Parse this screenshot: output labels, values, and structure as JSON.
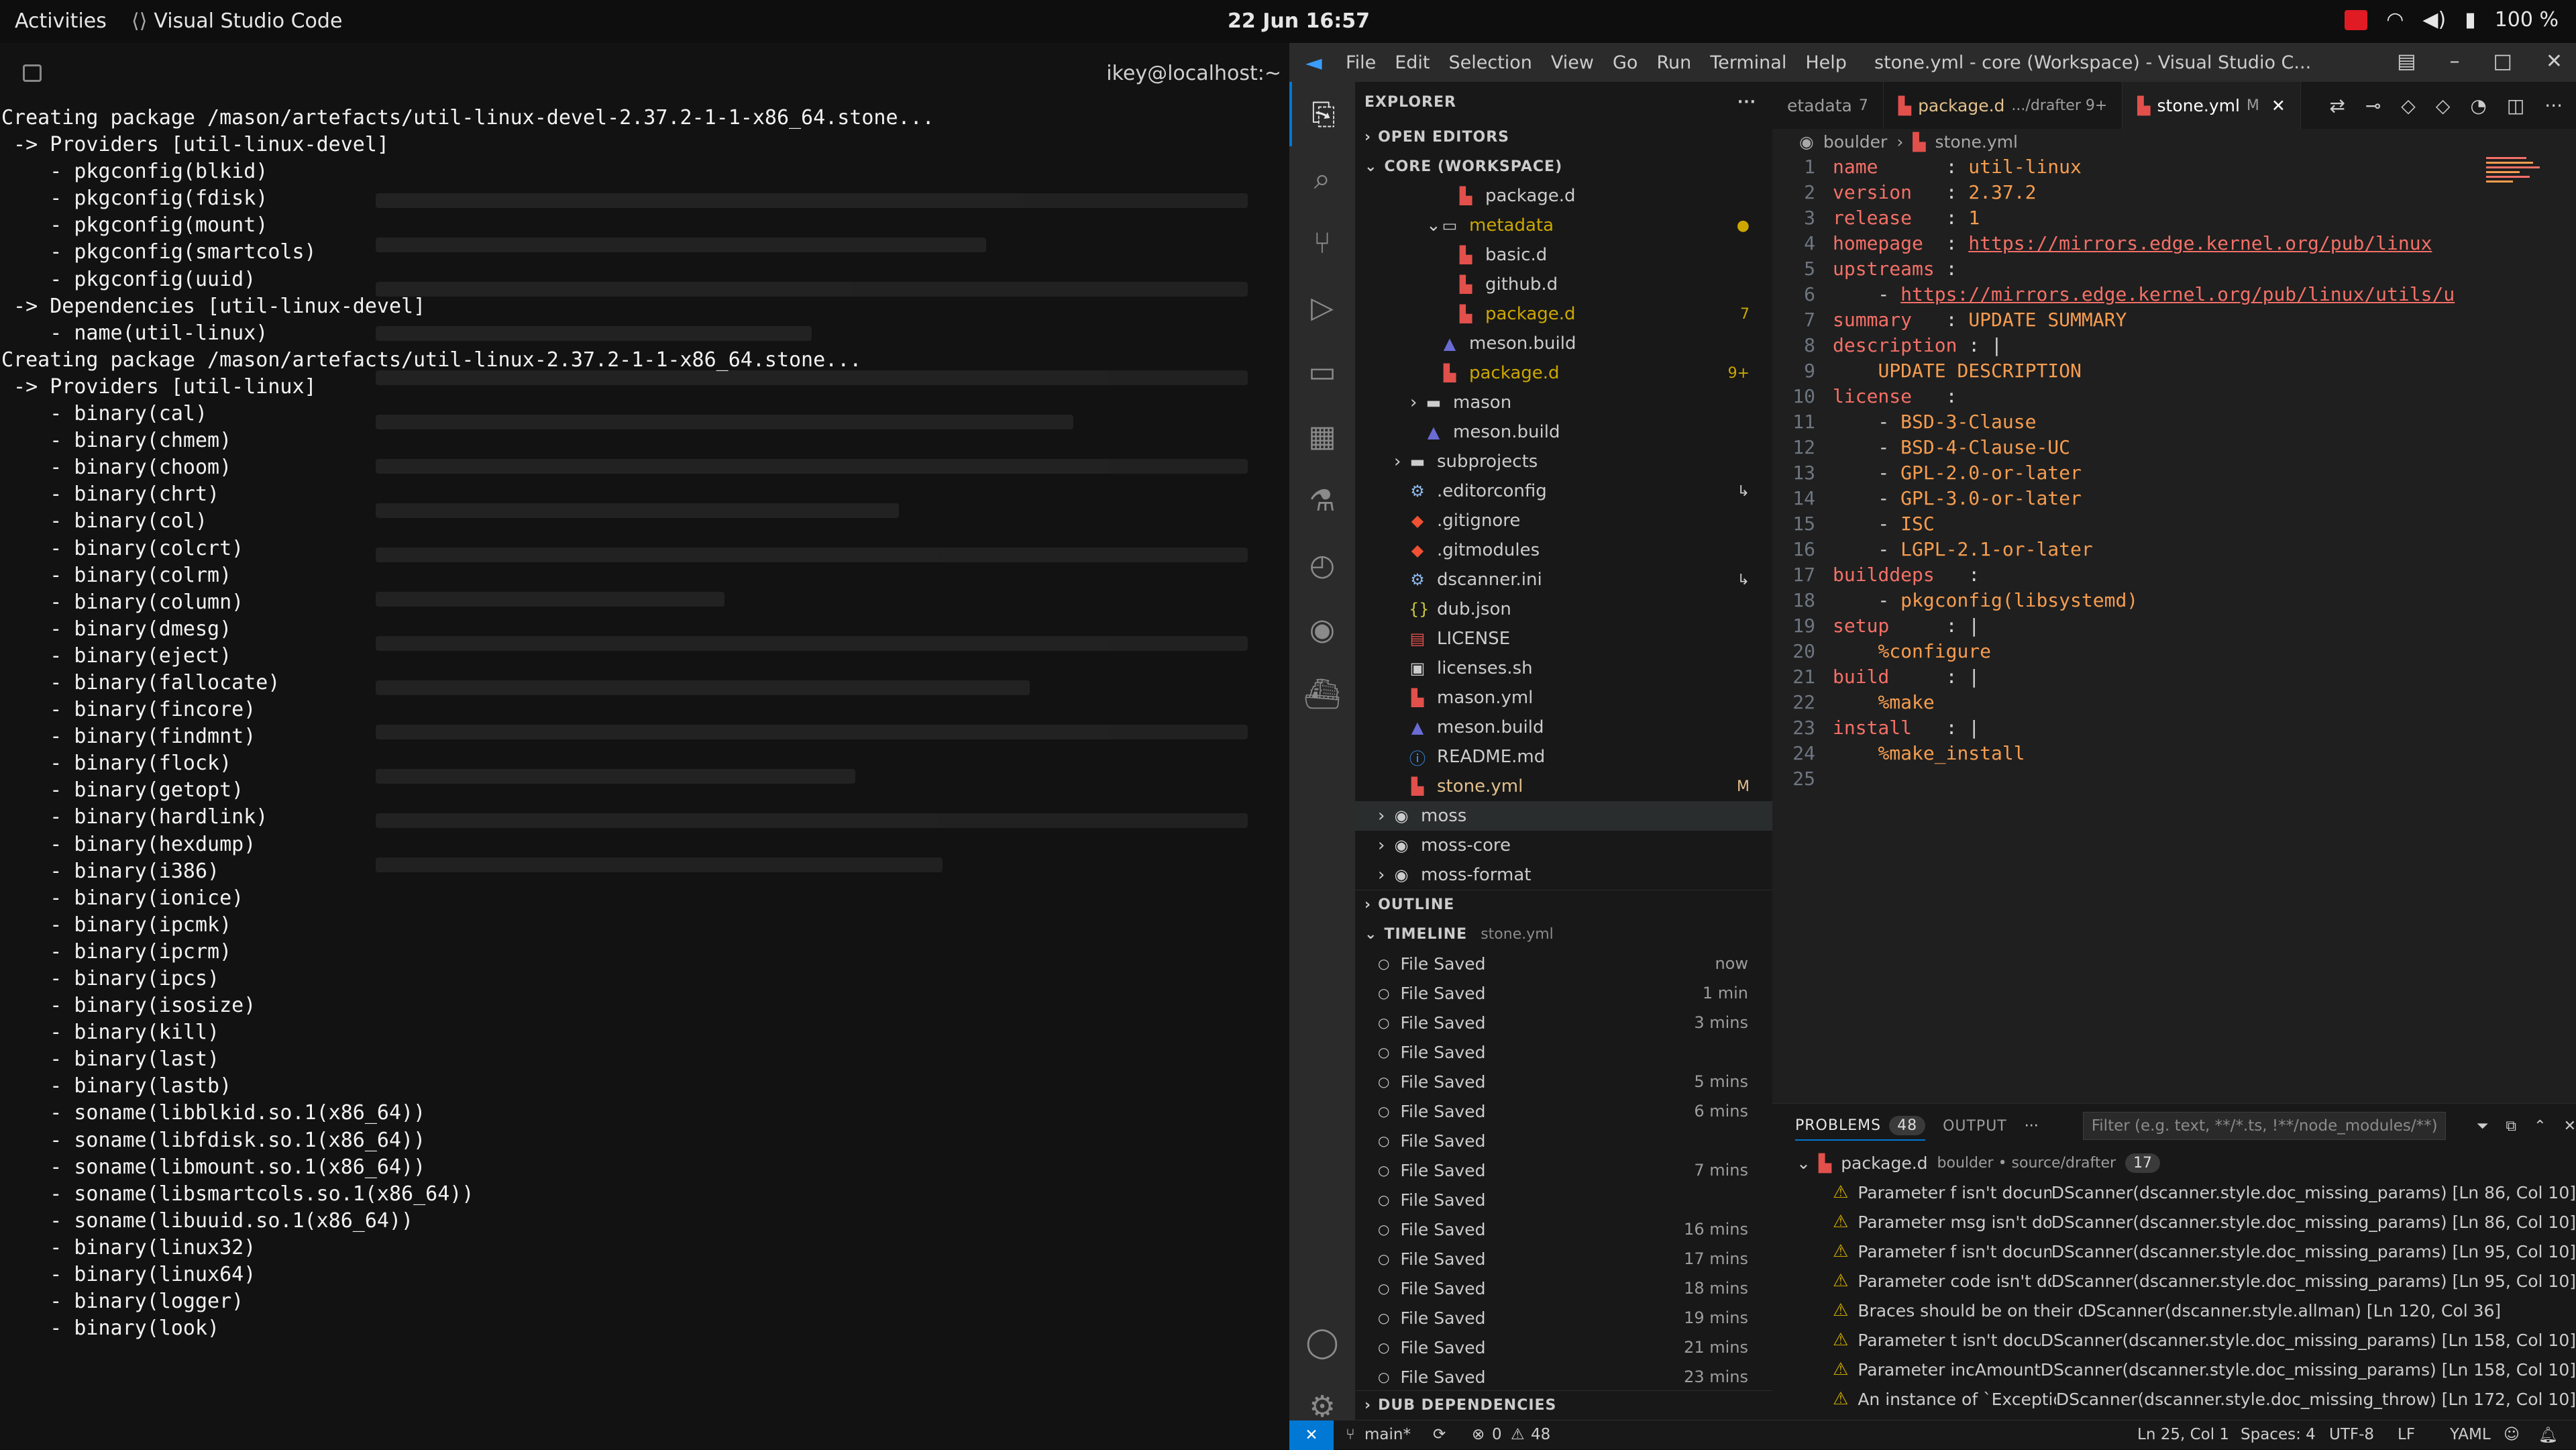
{
  "topbar": {
    "activities": "Activities",
    "app_name": "Visual Studio Code",
    "clock": "22 Jun  16:57",
    "battery": "100 %"
  },
  "terminal": {
    "user": "ikey@localhost:~",
    "lines": [
      "Creating package /mason/artefacts/util-linux-devel-2.37.2-1-1-x86_64.stone...",
      "",
      " -> Providers [util-linux-devel]",
      "    - pkgconfig(blkid)",
      "    - pkgconfig(fdisk)",
      "    - pkgconfig(mount)",
      "    - pkgconfig(smartcols)",
      "    - pkgconfig(uuid)",
      "",
      " -> Dependencies [util-linux-devel]",
      "    - name(util-linux)",
      "",
      "Creating package /mason/artefacts/util-linux-2.37.2-1-1-x86_64.stone...",
      "",
      " -> Providers [util-linux]",
      "    - binary(cal)",
      "    - binary(chmem)",
      "    - binary(choom)",
      "    - binary(chrt)",
      "    - binary(col)",
      "    - binary(colcrt)",
      "    - binary(colrm)",
      "    - binary(column)",
      "    - binary(dmesg)",
      "    - binary(eject)",
      "    - binary(fallocate)",
      "    - binary(fincore)",
      "    - binary(findmnt)",
      "    - binary(flock)",
      "    - binary(getopt)",
      "    - binary(hardlink)",
      "    - binary(hexdump)",
      "    - binary(i386)",
      "    - binary(ionice)",
      "    - binary(ipcmk)",
      "    - binary(ipcrm)",
      "    - binary(ipcs)",
      "    - binary(isosize)",
      "    - binary(kill)",
      "    - binary(last)",
      "    - binary(lastb)",
      "    - soname(libblkid.so.1(x86_64))",
      "    - soname(libfdisk.so.1(x86_64))",
      "    - soname(libmount.so.1(x86_64))",
      "    - soname(libsmartcols.so.1(x86_64))",
      "    - soname(libuuid.so.1(x86_64))",
      "    - binary(linux32)",
      "    - binary(linux64)",
      "    - binary(logger)",
      "    - binary(look)"
    ]
  },
  "vscode": {
    "menu": [
      "File",
      "Edit",
      "Selection",
      "View",
      "Go",
      "Run",
      "Terminal",
      "Help"
    ],
    "window_title": "stone.yml - core (Workspace) - Visual Studio C...",
    "explorer_title": "EXPLORER",
    "sections": {
      "open_editors": "OPEN EDITORS",
      "workspace": "CORE (WORKSPACE)",
      "outline": "OUTLINE",
      "timeline": "TIMELINE",
      "timeline_file": "stone.yml",
      "dub": "DUB DEPENDENCIES"
    },
    "tree": [
      {
        "label": "package.d",
        "indent": 2,
        "icon": "d",
        "color": "#cccccc",
        "badge": ""
      },
      {
        "label": "metadata",
        "indent": 1,
        "icon": "folder-open",
        "color": "#cca700",
        "badge": "●"
      },
      {
        "label": "basic.d",
        "indent": 2,
        "icon": "d",
        "color": "#cccccc",
        "badge": ""
      },
      {
        "label": "github.d",
        "indent": 2,
        "icon": "d",
        "color": "#cccccc",
        "badge": ""
      },
      {
        "label": "package.d",
        "indent": 2,
        "icon": "d",
        "color": "#cca700",
        "badge": "7"
      },
      {
        "label": "meson.build",
        "indent": 1,
        "icon": "meson",
        "color": "#cccccc",
        "badge": ""
      },
      {
        "label": "package.d",
        "indent": 1,
        "icon": "d",
        "color": "#cca700",
        "badge": "9+"
      },
      {
        "label": "mason",
        "indent": 0,
        "icon": "folder",
        "color": "#cccccc",
        "badge": ""
      },
      {
        "label": "meson.build",
        "indent": 0,
        "icon": "meson",
        "color": "#cccccc",
        "badge": ""
      },
      {
        "label": "subprojects",
        "indent": -1,
        "icon": "folder",
        "color": "#cccccc",
        "badge": ""
      },
      {
        "label": ".editorconfig",
        "indent": -1,
        "icon": "gear",
        "color": "#cccccc",
        "badge": "↳"
      },
      {
        "label": ".gitignore",
        "indent": -1,
        "icon": "git",
        "color": "#cccccc",
        "badge": ""
      },
      {
        "label": ".gitmodules",
        "indent": -1,
        "icon": "git",
        "color": "#cccccc",
        "badge": ""
      },
      {
        "label": "dscanner.ini",
        "indent": -1,
        "icon": "gear",
        "color": "#cccccc",
        "badge": "↳"
      },
      {
        "label": "dub.json",
        "indent": -1,
        "icon": "json",
        "color": "#cccccc",
        "badge": ""
      },
      {
        "label": "LICENSE",
        "indent": -1,
        "icon": "license",
        "color": "#cccccc",
        "badge": ""
      },
      {
        "label": "licenses.sh",
        "indent": -1,
        "icon": "shell",
        "color": "#cccccc",
        "badge": ""
      },
      {
        "label": "mason.yml",
        "indent": -1,
        "icon": "yaml",
        "color": "#cccccc",
        "badge": ""
      },
      {
        "label": "meson.build",
        "indent": -1,
        "icon": "meson",
        "color": "#cccccc",
        "badge": ""
      },
      {
        "label": "README.md",
        "indent": -1,
        "icon": "info",
        "color": "#cccccc",
        "badge": ""
      },
      {
        "label": "stone.yml",
        "indent": -1,
        "icon": "yaml",
        "color": "#e2c08d",
        "badge": "M"
      },
      {
        "label": "moss",
        "indent": -2,
        "icon": "repo",
        "color": "#cccccc",
        "badge": ""
      },
      {
        "label": "moss-core",
        "indent": -2,
        "icon": "repo",
        "color": "#cccccc",
        "badge": ""
      },
      {
        "label": "moss-format",
        "indent": -2,
        "icon": "repo",
        "color": "#cccccc",
        "badge": ""
      }
    ],
    "timeline": [
      {
        "label": "File Saved",
        "when": "now"
      },
      {
        "label": "File Saved",
        "when": "1 min"
      },
      {
        "label": "File Saved",
        "when": "3 mins"
      },
      {
        "label": "File Saved",
        "when": ""
      },
      {
        "label": "File Saved",
        "when": "5 mins"
      },
      {
        "label": "File Saved",
        "when": "6 mins"
      },
      {
        "label": "File Saved",
        "when": ""
      },
      {
        "label": "File Saved",
        "when": "7 mins"
      },
      {
        "label": "File Saved",
        "when": ""
      },
      {
        "label": "File Saved",
        "when": "16 mins"
      },
      {
        "label": "File Saved",
        "when": "17 mins"
      },
      {
        "label": "File Saved",
        "when": "18 mins"
      },
      {
        "label": "File Saved",
        "when": "19 mins"
      },
      {
        "label": "File Saved",
        "when": "21 mins"
      },
      {
        "label": "File Saved",
        "when": "23 mins"
      }
    ],
    "tabs": [
      {
        "label": "etadata",
        "detail": "7",
        "active": false
      },
      {
        "label": "package.d",
        "detail": ".../drafter 9+",
        "active": false
      },
      {
        "label": "stone.yml",
        "detail": "M",
        "active": true
      }
    ],
    "breadcrumb": [
      "boulder",
      "stone.yml"
    ],
    "code": [
      [
        [
          "k",
          "name"
        ],
        [
          "p",
          "      : "
        ],
        [
          "v",
          "util-linux"
        ]
      ],
      [
        [
          "k",
          "version"
        ],
        [
          "p",
          "   : "
        ],
        [
          "v",
          "2.37.2"
        ]
      ],
      [
        [
          "k",
          "release"
        ],
        [
          "p",
          "   : "
        ],
        [
          "v",
          "1"
        ]
      ],
      [
        [
          "k",
          "homepage"
        ],
        [
          "p",
          "  : "
        ],
        [
          "u",
          "https://mirrors.edge.kernel.org/pub/linux"
        ]
      ],
      [
        [
          "k",
          "upstreams"
        ],
        [
          "p",
          " :"
        ]
      ],
      [
        [
          "p",
          "    - "
        ],
        [
          "u",
          "https://mirrors.edge.kernel.org/pub/linux/utils/u"
        ]
      ],
      [
        [
          "k",
          "summary"
        ],
        [
          "p",
          "   : "
        ],
        [
          "v",
          "UPDATE SUMMARY"
        ]
      ],
      [
        [
          "k",
          "description"
        ],
        [
          "p",
          " : |"
        ]
      ],
      [
        [
          "p",
          "    "
        ],
        [
          "v",
          "UPDATE DESCRIPTION"
        ]
      ],
      [
        [
          "k",
          "license"
        ],
        [
          "p",
          "   :"
        ]
      ],
      [
        [
          "p",
          "    - "
        ],
        [
          "v",
          "BSD-3-Clause"
        ]
      ],
      [
        [
          "p",
          "    - "
        ],
        [
          "v",
          "BSD-4-Clause-UC"
        ]
      ],
      [
        [
          "p",
          "    - "
        ],
        [
          "v",
          "GPL-2.0-or-later"
        ]
      ],
      [
        [
          "p",
          "    - "
        ],
        [
          "v",
          "GPL-3.0-or-later"
        ]
      ],
      [
        [
          "p",
          "    - "
        ],
        [
          "v",
          "ISC"
        ]
      ],
      [
        [
          "p",
          "    - "
        ],
        [
          "v",
          "LGPL-2.1-or-later"
        ]
      ],
      [
        [
          "k",
          "builddeps"
        ],
        [
          "p",
          "   :"
        ]
      ],
      [
        [
          "p",
          "    - "
        ],
        [
          "v",
          "pkgconfig(libsystemd)"
        ]
      ],
      [
        [
          "k",
          "setup"
        ],
        [
          "p",
          "     : |"
        ]
      ],
      [
        [
          "p",
          "    "
        ],
        [
          "v",
          "%configure"
        ]
      ],
      [
        [
          "k",
          "build"
        ],
        [
          "p",
          "     : |"
        ]
      ],
      [
        [
          "p",
          "    "
        ],
        [
          "v",
          "%make"
        ]
      ],
      [
        [
          "k",
          "install"
        ],
        [
          "p",
          "   : |"
        ]
      ],
      [
        [
          "p",
          "    "
        ],
        [
          "v",
          "%make_install"
        ]
      ],
      []
    ],
    "panel": {
      "problems_label": "PROBLEMS",
      "problems_count": "48",
      "output_label": "OUTPUT",
      "filter_placeholder": "Filter (e.g. text, **/*.ts, !**/node_modules/**)",
      "group_file": "package.d",
      "group_path": "boulder • source/drafter",
      "group_count": "17",
      "items": [
        {
          "msg": "Parameter f isn't docume...",
          "src": "DScanner(dscanner.style.doc_missing_params)  [Ln 86, Col 10]"
        },
        {
          "msg": "Parameter msg isn't docu...",
          "src": "DScanner(dscanner.style.doc_missing_params)  [Ln 86, Col 10]"
        },
        {
          "msg": "Parameter f isn't docume...",
          "src": "DScanner(dscanner.style.doc_missing_params)  [Ln 95, Col 10]"
        },
        {
          "msg": "Parameter code isn't doc...",
          "src": "DScanner(dscanner.style.doc_missing_params)  [Ln 95, Col 10]"
        },
        {
          "msg": "Braces should be on their own line",
          "src": "DScanner(dscanner.style.allman)  [Ln 120, Col 36]"
        },
        {
          "msg": "Parameter t isn't docum...",
          "src": "DScanner(dscanner.style.doc_missing_params)  [Ln 158, Col 10]"
        },
        {
          "msg": "Parameter incAmount is...",
          "src": "DScanner(dscanner.style.doc_missing_params)  [Ln 158, Col 10]"
        },
        {
          "msg": "An instance of `Exception...",
          "src": "DScanner(dscanner.style.doc_missing_throw)  [Ln 172, Col 10]"
        }
      ]
    },
    "status": {
      "branch": "main*",
      "errors": "0",
      "warnings": "48",
      "position": "Ln 25, Col 1",
      "spaces": "Spaces: 4",
      "encoding": "UTF-8",
      "eol": "LF",
      "language": "YAML"
    },
    "colors": {
      "accent": "#0078d4",
      "key": "#f47067",
      "value": "#f69d50"
    }
  }
}
